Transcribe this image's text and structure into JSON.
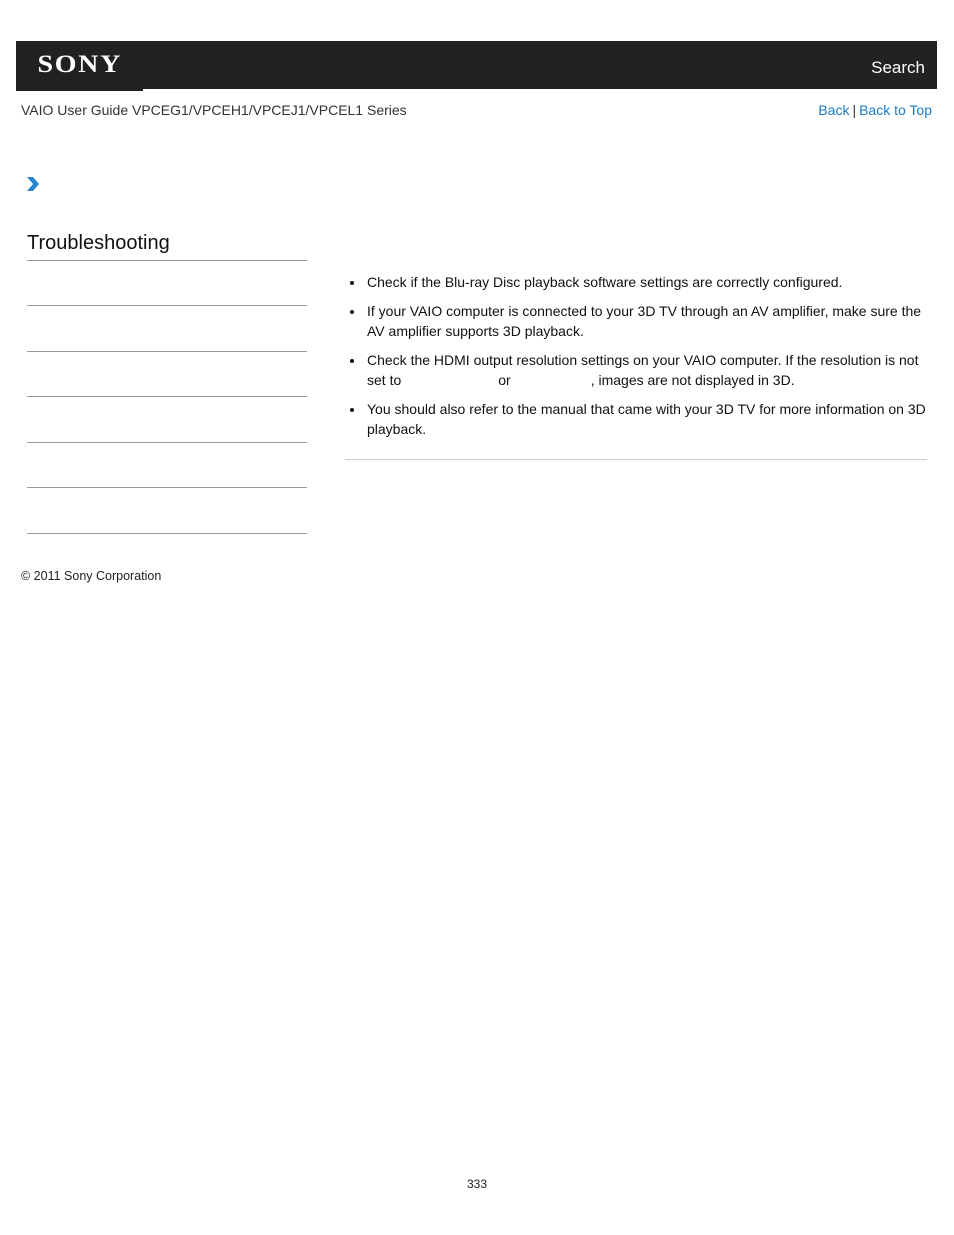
{
  "header": {
    "logo": "SONY",
    "search_label": "Search"
  },
  "guide": {
    "title": "VAIO User Guide VPCEG1/VPCEH1/VPCEJ1/VPCEL1 Series",
    "back_label": "Back",
    "separator": "|",
    "back_to_top_label": "Back to Top"
  },
  "breadcrumb": {
    "icon": "chevron-right-icon"
  },
  "sidebar": {
    "section_title": "Troubleshooting",
    "item_count": 6
  },
  "content": {
    "bullets": [
      {
        "text": "Check if the Blu-ray Disc playback software settings are correctly configured."
      },
      {
        "text": "If your VAIO computer is connected to your 3D TV through an AV amplifier, make sure the AV amplifier supports 3D playback."
      },
      {
        "text_before": "Check the HDMI output resolution settings on your VAIO computer. If the resolution is not set to",
        "text_middle": "or",
        "text_after": ", images are not displayed in 3D."
      },
      {
        "text": "You should also refer to the manual that came with your 3D TV for more information on 3D playback."
      }
    ]
  },
  "footer": {
    "copyright": "© 2011 Sony Corporation",
    "page_number": "333"
  },
  "colors": {
    "header_bg": "#222222",
    "link": "#1a7ac6",
    "chevron": "#2a86cf"
  }
}
